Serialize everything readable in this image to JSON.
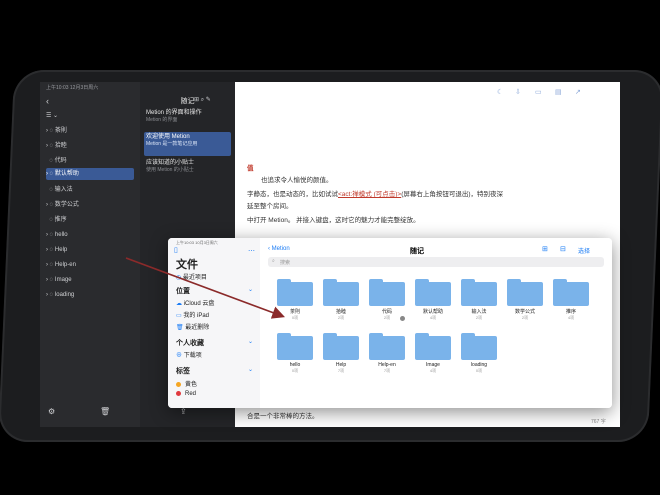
{
  "colors": {
    "accent": "#3a5a96",
    "folder": "#7ab3ea",
    "link": "#c0392b",
    "tag_yellow": "#f5a623",
    "tag_red": "#e0393e"
  },
  "status_bar": {
    "time": "上午10:03  12月3日周六"
  },
  "sidebar": {
    "back_icon": "chevron-left-icon",
    "title_icon": "list-icon",
    "items": [
      {
        "label": "茶則"
      },
      {
        "label": "拾睦"
      },
      {
        "label": "代码"
      },
      {
        "label": "默认帮助"
      },
      {
        "label": "输入法"
      },
      {
        "label": "数学公式"
      },
      {
        "label": "推序"
      },
      {
        "label": "hello"
      },
      {
        "label": "Help"
      },
      {
        "label": "Help-en"
      },
      {
        "label": "Image"
      },
      {
        "label": "loading"
      }
    ]
  },
  "notes_list": {
    "title": "随记",
    "notes": [
      {
        "title": "Metion 的界面和操作",
        "sub": "Metion 的界面"
      },
      {
        "title": "欢迎使用 Metion",
        "sub": "Metion 是一款笔记应用"
      },
      {
        "title": "应该知道的小贴士",
        "sub": "使用 Metion 的小贴士"
      }
    ]
  },
  "editor": {
    "heading": "值",
    "lines": [
      "也追求令人愉悦的颜值。",
      "字静态，也是动态的，比如试试",
      "中打开 Metion。 并接入键盘，这时它的魅力才能完整绽放。"
    ],
    "link_text": "<act:禅模式 (可点击)>",
    "link_after": "(屏幕右上角按钮可退出)，特别夜深",
    "line2b": "延至整个房间。",
    "bottom_line1": "合是一个非常棒的方法。",
    "word_count": "767 字"
  },
  "files_app": {
    "status_time": "上午10:03  10月3日周六",
    "title": "文件",
    "recent": "最近项目",
    "locations_header": "位置",
    "locations": [
      "iCloud 云盘",
      "我的 iPad",
      "最近删除"
    ],
    "favorites_header": "个人收藏",
    "favorites": [
      "下载项"
    ],
    "tags_header": "标签",
    "tags": [
      "黄色",
      "Red"
    ],
    "breadcrumb_back": "Metion",
    "folder_title": "随记",
    "search_placeholder": "搜索",
    "select_label": "选择",
    "folders_row1": [
      {
        "name": "茶則",
        "count": "0项"
      },
      {
        "name": "拾睦",
        "count": "2项"
      },
      {
        "name": "代码",
        "count": "2项"
      },
      {
        "name": "默认帮助",
        "count": "4项"
      },
      {
        "name": "输入法",
        "count": "2项"
      },
      {
        "name": "数学公式",
        "count": "2项"
      },
      {
        "name": "推序",
        "count": "4项"
      }
    ],
    "folders_row2": [
      {
        "name": "hello",
        "count": "0项"
      },
      {
        "name": "Help",
        "count": "7项"
      },
      {
        "name": "Help-en",
        "count": "7项"
      },
      {
        "name": "Image",
        "count": "4项"
      },
      {
        "name": "loading",
        "count": "0项"
      }
    ]
  }
}
